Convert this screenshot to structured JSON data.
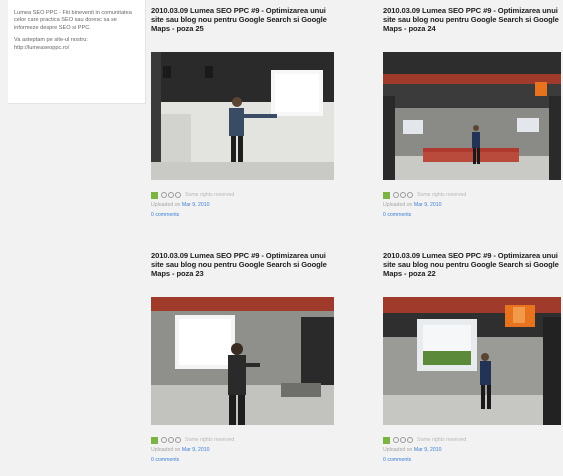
{
  "sidebar": {
    "text1": "Lumea SEO PPC - Fiti binevenit in comunitatea celor care practica SEO sau doresc sa se informeze despre SEO si PPC.",
    "text2": "Va asteptam pe site-ul nostru: http://lumeaseoppc.ro/"
  },
  "photos": [
    {
      "title": "2010.03.09 Lumea SEO PPC #9 - Optimizarea unui site sau blog nou pentru Google Search si Google Maps - poza 25",
      "license": "Some rights reserved",
      "uploaded_prefix": "Uploaded on",
      "date": "Mar 9, 2010",
      "comments": "0 comments"
    },
    {
      "title": "2010.03.09 Lumea SEO PPC #9 - Optimizarea unui site sau blog nou pentru Google Search si Google Maps - poza 24",
      "license": "Some rights reserved",
      "uploaded_prefix": "Uploaded on",
      "date": "Mar 9, 2010",
      "comments": "0 comments"
    },
    {
      "title": "2010.03.09 Lumea SEO PPC #9 - Optimizarea unui site sau blog nou pentru Google Search si Google Maps - poza 23",
      "license": "Some rights reserved",
      "uploaded_prefix": "Uploaded on",
      "date": "Mar 9, 2010",
      "comments": "0 comments"
    },
    {
      "title": "2010.03.09 Lumea SEO PPC #9 - Optimizarea unui site sau blog nou pentru Google Search si Google Maps - poza 22",
      "license": "Some rights reserved",
      "uploaded_prefix": "Uploaded on",
      "date": "Mar 9, 2010",
      "comments": "0 comments"
    }
  ],
  "colors": {
    "link": "#3d7fd6",
    "license_green": "#7cb342",
    "background": "#f2f2f2"
  }
}
